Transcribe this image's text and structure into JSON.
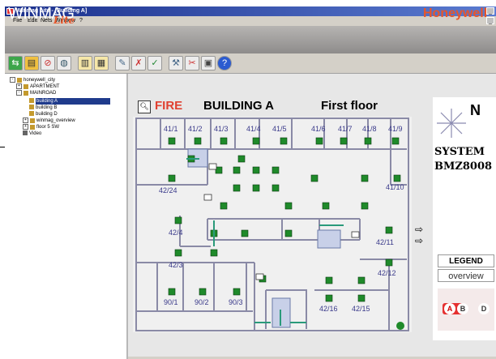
{
  "window": {
    "title": "Winmag Lite - [Building A]"
  },
  "menu": {
    "items": [
      "File",
      "Edit",
      "Nets",
      "Window",
      "?"
    ]
  },
  "brand": {
    "app_name": "WINMAG",
    "app_sub": "Lite",
    "company": "Honeywell"
  },
  "toolbar": {
    "icons": [
      "network-icon",
      "folder-icon",
      "no-entry-icon",
      "globe-icon",
      "panel-icon",
      "panel2-icon",
      "pen-icon",
      "cross-marker-icon",
      "check-mark-icon",
      "tools-icon",
      "scissors-icon",
      "image-icon",
      "help-icon"
    ]
  },
  "tree": {
    "items": [
      {
        "label": "honeywell_city",
        "level": 0,
        "toggle": "-"
      },
      {
        "label": "APARTMENT",
        "level": 1,
        "toggle": "+"
      },
      {
        "label": "MAINROAD",
        "level": 1,
        "toggle": "-"
      },
      {
        "label": "building A",
        "level": 2,
        "toggle": "",
        "selected": true
      },
      {
        "label": "building B",
        "level": 2,
        "toggle": ""
      },
      {
        "label": "building D",
        "level": 2,
        "toggle": ""
      },
      {
        "label": "winmag_overview",
        "level": 1,
        "toggle": "+"
      },
      {
        "label": "floor 5 SW",
        "level": 1,
        "toggle": "+"
      },
      {
        "label": "Video",
        "level": 1,
        "toggle": ""
      }
    ]
  },
  "map": {
    "alarm": "FIRE",
    "building": "BUILDING A",
    "floor": "First floor",
    "rooms": [
      {
        "label": "41/1"
      },
      {
        "label": "41/2"
      },
      {
        "label": "41/3"
      },
      {
        "label": "41/4"
      },
      {
        "label": "41/5"
      },
      {
        "label": "41/6"
      },
      {
        "label": "41/7"
      },
      {
        "label": "41/8"
      },
      {
        "label": "41/9"
      },
      {
        "label": "41/10"
      },
      {
        "label": "42/24"
      },
      {
        "label": "42/4"
      },
      {
        "label": "42/3"
      },
      {
        "label": "42/11"
      },
      {
        "label": "42/12"
      },
      {
        "label": "90/1"
      },
      {
        "label": "90/2"
      },
      {
        "label": "90/3"
      },
      {
        "label": "42/16"
      },
      {
        "label": "42/15"
      }
    ]
  },
  "system": {
    "header_letter": "N",
    "line1": "SYSTEM",
    "line2": "BMZ8008"
  },
  "buttons": {
    "legend": "LEGEND",
    "overview": "overview"
  },
  "mini_overview": {
    "markers": [
      "A",
      "B",
      "D"
    ],
    "active": "A"
  },
  "colors": {
    "alarm_red": "#e04030",
    "brand_orange": "#e8562a",
    "detector_green": "#1f8a2a",
    "titlebar": "#1a2f8c"
  }
}
